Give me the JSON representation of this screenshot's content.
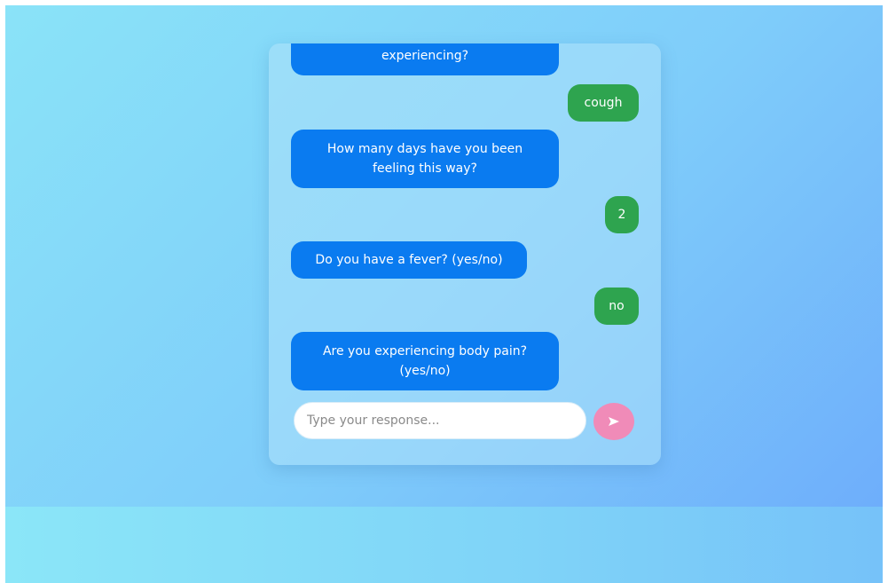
{
  "chat": {
    "messages": [
      {
        "sender": "bot",
        "text": "experiencing?"
      },
      {
        "sender": "user",
        "text": "cough"
      },
      {
        "sender": "bot",
        "text": "How many days have you been feeling this way?"
      },
      {
        "sender": "user",
        "text": "2"
      },
      {
        "sender": "bot",
        "text": "Do you have a fever? (yes/no)"
      },
      {
        "sender": "user",
        "text": "no"
      },
      {
        "sender": "bot",
        "text": "Are you experiencing body pain? (yes/no)"
      }
    ]
  },
  "input": {
    "value": "",
    "placeholder": "Type your response..."
  },
  "send_button": {
    "icon": "send-icon"
  },
  "colors": {
    "bot_bubble": "#0a7bf0",
    "user_bubble": "#2ea44f",
    "send_button": "#f08bb8",
    "background_start": "#8ae3f8",
    "background_end": "#6eaefb"
  }
}
